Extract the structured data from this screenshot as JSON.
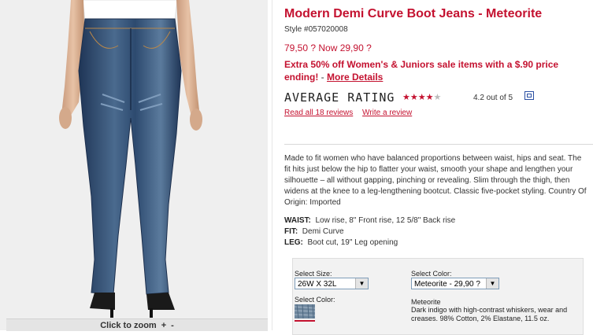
{
  "product": {
    "title": "Modern Demi Curve Boot Jeans - Meteorite",
    "style": "Style #057020008",
    "price_line": "79,50 ? Now 29,90 ?",
    "promo_text": "Extra 50% off Women's & Juniors sale items with a $.90 price ending!",
    "promo_separator": " - ",
    "promo_link": "More Details"
  },
  "rating": {
    "label": "AVERAGE RATING",
    "stars_value": 4.2,
    "stars_max": 5,
    "text": "4.2 out of 5",
    "read_reviews": "Read all 18 reviews",
    "write_review": "Write a review"
  },
  "description": "Made to fit women who have balanced proportions between waist, hips and seat. The fit hits just below the hip to flatter your waist, smooth your shape and lengthen your silhouette – all without gapping, pinching or revealing. Slim through the thigh, then widens at the knee to a leg-lengthening bootcut. Classic five-pocket styling. Country Of Origin: Imported",
  "specs": {
    "waist_label": "WAIST:",
    "waist_value": "Low rise, 8\" Front rise, 12 5/8\" Back rise",
    "fit_label": "FIT:",
    "fit_value": "Demi Curve",
    "leg_label": "LEG:",
    "leg_value": "Boot cut, 19\" Leg opening"
  },
  "selection": {
    "size_label": "Select Size:",
    "size_value": "26W X 32L",
    "color_label": "Select Color:",
    "color_value": "Meteorite - 29,90 ?",
    "color_swatch_label": "Select Color:",
    "color_name": "Meteorite",
    "color_desc": "Dark indigo with high-contrast whiskers, wear and creases. 98% Cotton, 2% Elastane, 11.5 oz."
  },
  "zoom": {
    "label": "Click to zoom",
    "plus": "+",
    "minus": "-"
  },
  "colors": {
    "brand_red": "#c41230",
    "denim": "#2e4b6e",
    "panel_bg": "#efefef"
  },
  "icons": {
    "stars": "star-rating-icon",
    "popup": "popup-window-icon",
    "dropdown": "chevron-down-icon"
  }
}
